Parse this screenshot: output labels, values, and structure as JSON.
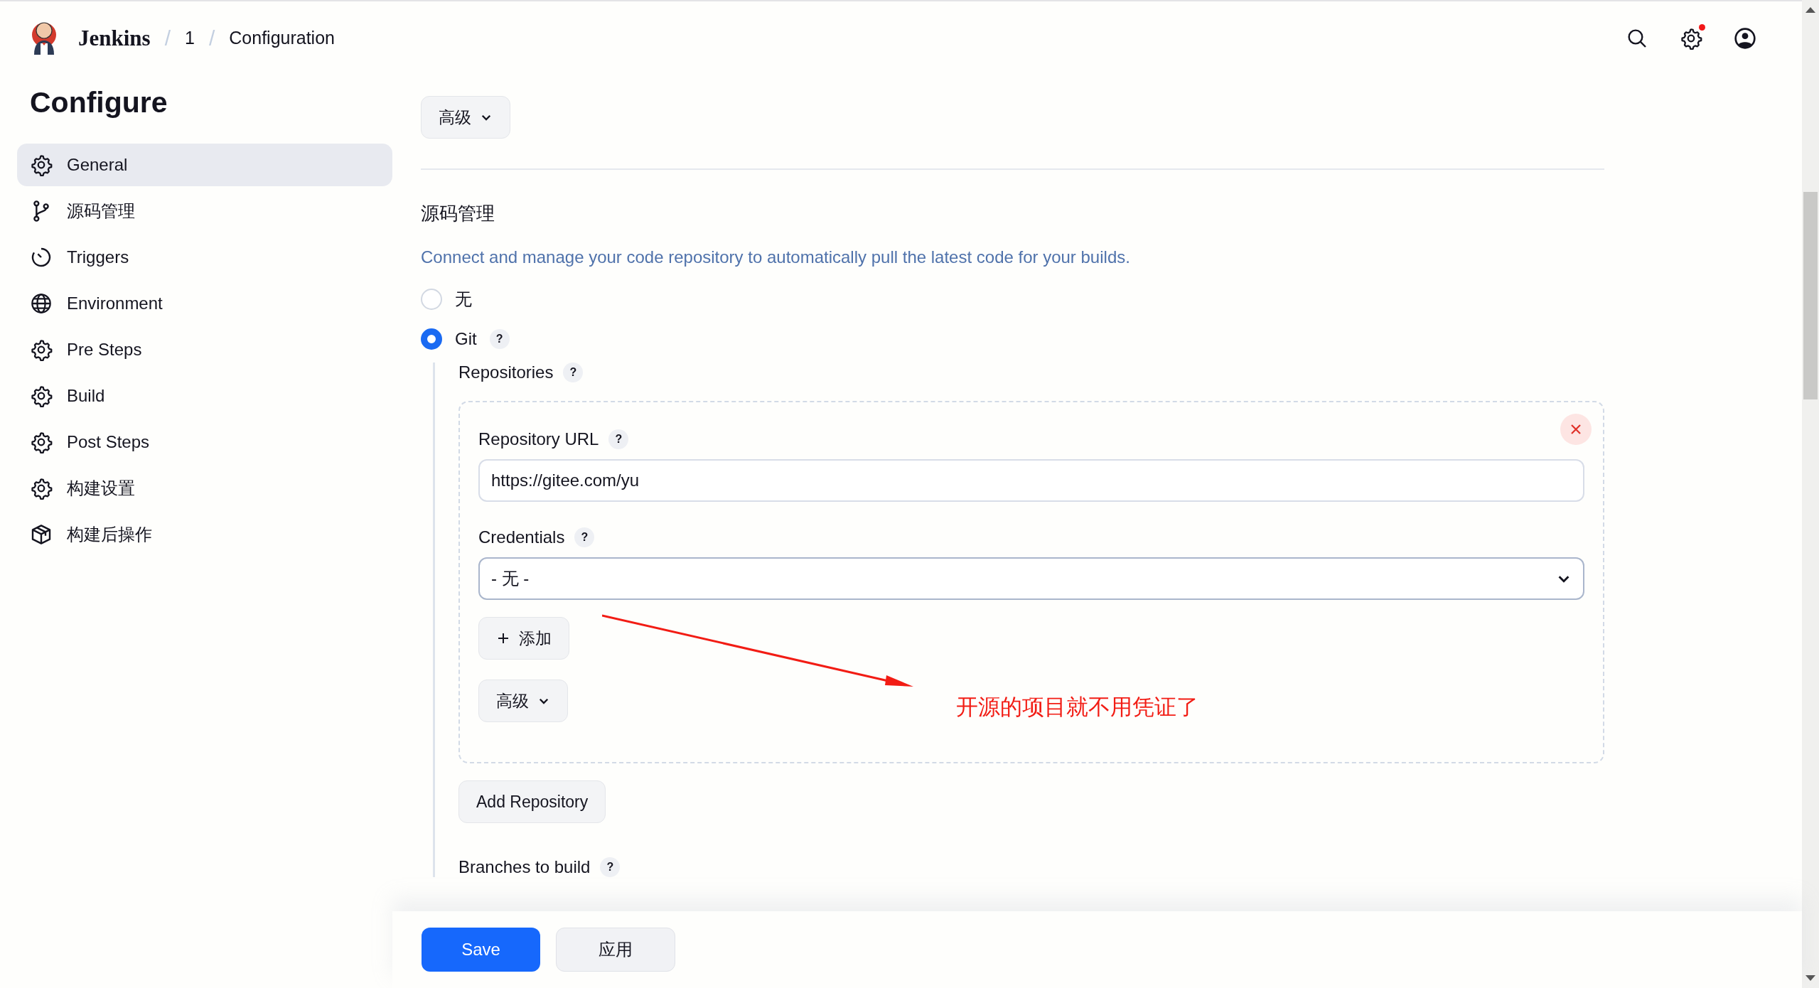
{
  "header": {
    "brand": "Jenkins",
    "breadcrumbs": [
      {
        "separator": "/",
        "label": "1"
      },
      {
        "separator": "/",
        "label": "Configuration"
      }
    ],
    "notification": true
  },
  "sidebar": {
    "title": "Configure",
    "items": [
      {
        "label": "General",
        "kind": "gear",
        "selected": true
      },
      {
        "label": "源码管理",
        "kind": "branch",
        "selected": false
      },
      {
        "label": "Triggers",
        "kind": "timer",
        "selected": false
      },
      {
        "label": "Environment",
        "kind": "globe",
        "selected": false
      },
      {
        "label": "Pre Steps",
        "kind": "gear",
        "selected": false
      },
      {
        "label": "Build",
        "kind": "gear",
        "selected": false
      },
      {
        "label": "Post Steps",
        "kind": "gear",
        "selected": false
      },
      {
        "label": "构建设置",
        "kind": "gear",
        "selected": false
      },
      {
        "label": "构建后操作",
        "kind": "package",
        "selected": false
      }
    ]
  },
  "top_advanced": "高级",
  "section": {
    "title": "源码管理",
    "description": "Connect and manage your code repository to automatically pull the latest code for your builds.",
    "options": [
      {
        "label": "无",
        "selected": false
      },
      {
        "label": "Git",
        "selected": true,
        "help": "?"
      }
    ]
  },
  "repositories": {
    "label": "Repositories",
    "help": "?",
    "items": [
      {
        "fields": [
          {
            "kind": "text",
            "label": "Repository URL",
            "help": "?",
            "value": "https://gitee.com/yu"
          },
          {
            "kind": "select",
            "label": "Credentials",
            "help": "?",
            "value": "- 无 -"
          }
        ],
        "add_label": "添加",
        "advanced": "高级"
      }
    ],
    "add_button": "Add Repository"
  },
  "branches": {
    "label": "Branches to build",
    "help": "?"
  },
  "annotation": {
    "text": "开源的项目就不用凭证了"
  },
  "footer": {
    "buttons": [
      {
        "label": "Save",
        "kind": "primary"
      },
      {
        "label": "应用",
        "kind": "secondary"
      }
    ]
  }
}
